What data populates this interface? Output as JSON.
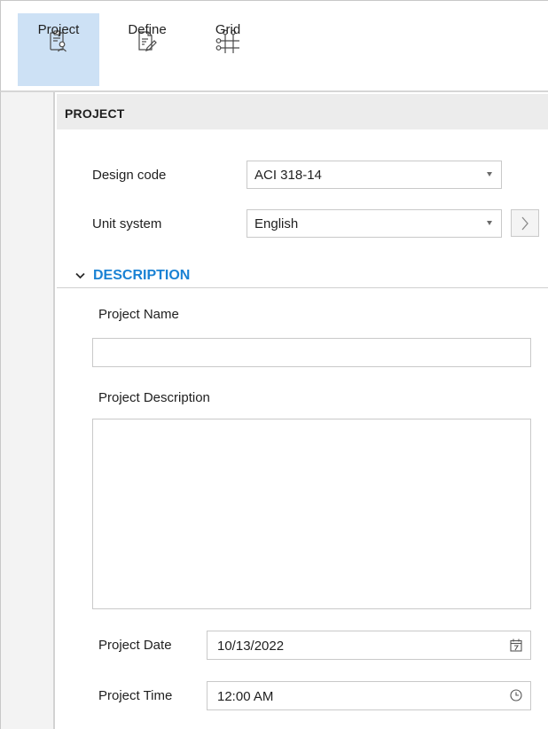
{
  "ribbon": {
    "buttons": [
      {
        "label": "Project",
        "icon": "project-icon",
        "active": true
      },
      {
        "label": "Define",
        "icon": "define-icon",
        "active": false
      },
      {
        "label": "Grid",
        "icon": "grid-icon",
        "active": false
      }
    ]
  },
  "section": {
    "title": "PROJECT"
  },
  "settings": {
    "design_code": {
      "label": "Design code",
      "value": "ACI 318-14"
    },
    "unit_system": {
      "label": "Unit system",
      "value": "English"
    }
  },
  "description": {
    "title": "DESCRIPTION",
    "expanded": true,
    "project_name": {
      "label": "Project Name",
      "value": ""
    },
    "project_description": {
      "label": "Project Description",
      "value": ""
    },
    "project_date": {
      "label": "Project Date",
      "value": "10/13/2022"
    },
    "project_time": {
      "label": "Project Time",
      "value": "12:00 AM"
    }
  },
  "colors": {
    "accent": "#1a82d4",
    "active_tab": "#cde1f5",
    "rail": "#f3f3f3",
    "header": "#ececec"
  }
}
